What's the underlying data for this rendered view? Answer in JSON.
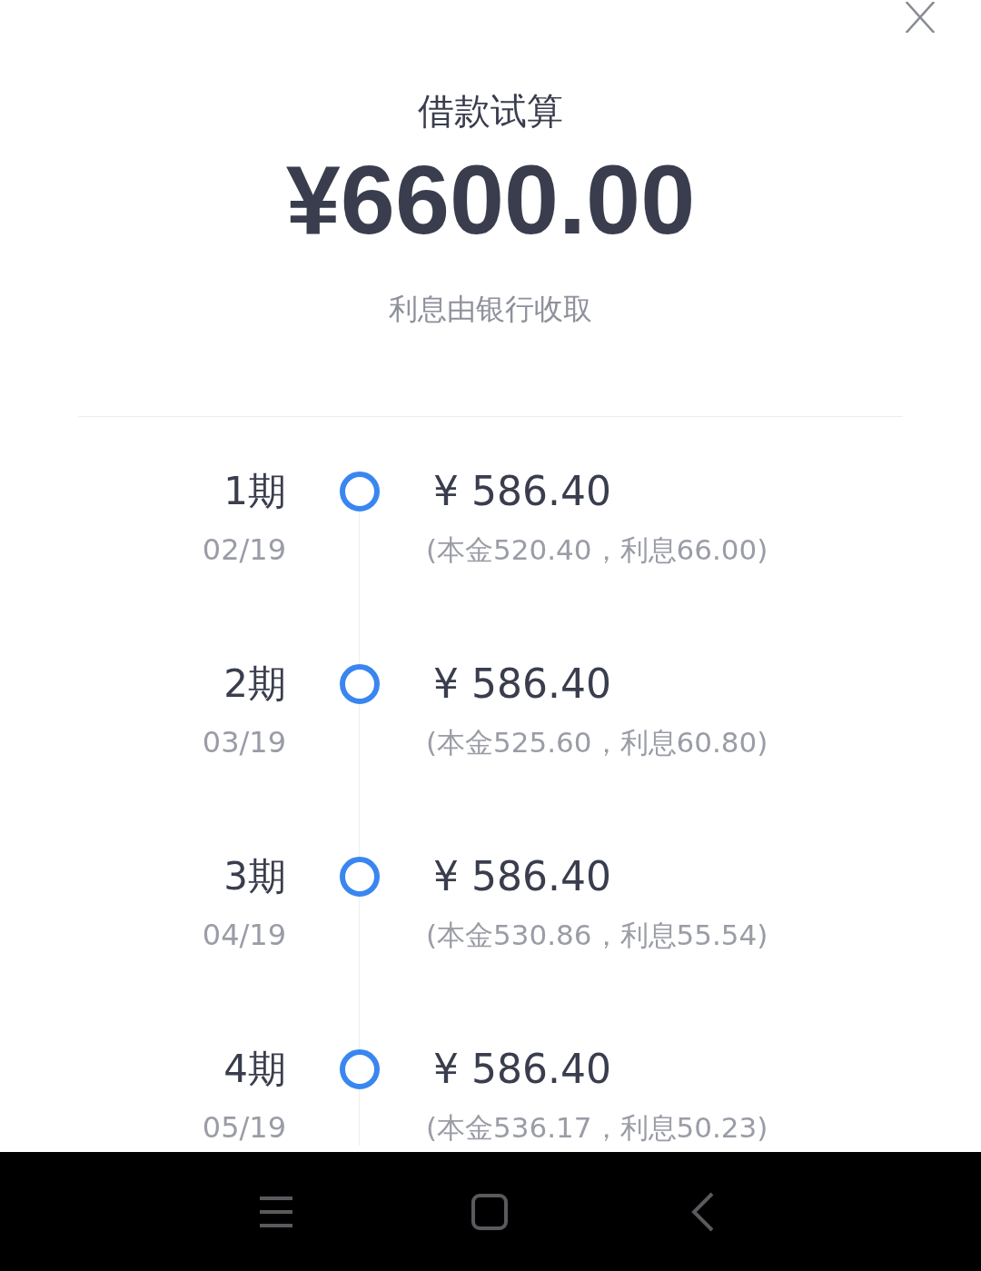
{
  "title": "借款试算",
  "amount": "¥6600.00",
  "subtitle": "利息由银行收取",
  "installments": [
    {
      "period": "1期",
      "date": "02/19",
      "amount": "¥ 586.40",
      "detail": "(本金520.40，利息66.00)"
    },
    {
      "period": "2期",
      "date": "03/19",
      "amount": "¥ 586.40",
      "detail": "(本金525.60，利息60.80)"
    },
    {
      "period": "3期",
      "date": "04/19",
      "amount": "¥ 586.40",
      "detail": "(本金530.86，利息55.54)"
    },
    {
      "period": "4期",
      "date": "05/19",
      "amount": "¥ 586.40",
      "detail": "(本金536.17，利息50.23)"
    }
  ]
}
